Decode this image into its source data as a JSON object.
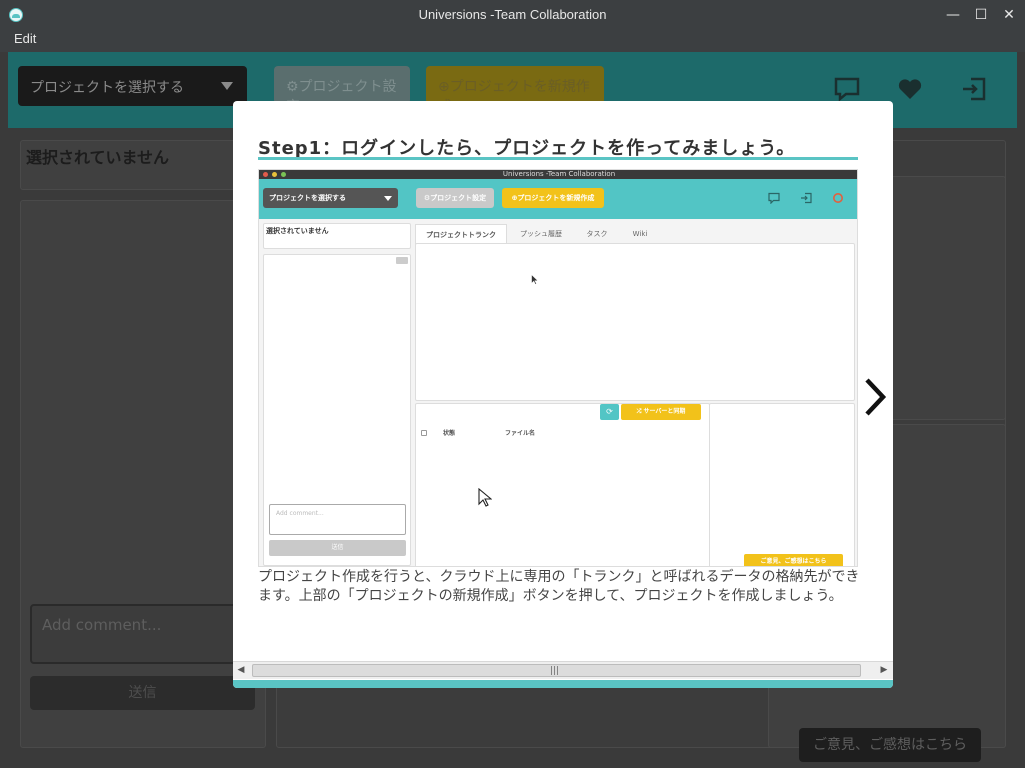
{
  "window": {
    "title": "Universions -Team Collaboration",
    "minimize": "—",
    "maximize": "☐",
    "close": "✕"
  },
  "menu": {
    "edit": "Edit"
  },
  "app": {
    "project_select_placeholder": "プロジェクトを選択する",
    "settings_button": "⚙プロジェクト設定",
    "new_project_button": "⊕プロジェクトを新規作成",
    "no_selection": "選択されていません",
    "comment_placeholder": "Add comment...",
    "send_button": "送信",
    "feedback_button": "ご意見、ご感想はこちら"
  },
  "modal": {
    "step_title": "Step1：ログインしたら、プロジェクトを作ってみましょう。",
    "description": "プロジェクト作成を行うと、クラウド上に専用の「トランク」と呼ばれるデータの格納先ができます。上部の「プロジェクトの新規作成」ボタンを押して、プロジェクトを作成しましょう。",
    "scroll_grip": "|||"
  },
  "screenshot": {
    "window_title": "Universions -Team Collaboration",
    "project_select": "プロジェクトを選択する",
    "settings_button": "⚙プロジェクト設定",
    "new_project_button": "⊕プロジェクトを新規作成",
    "no_selection": "選択されていません",
    "tabs": [
      "プロジェクトトランク",
      "プッシュ履歴",
      "タスク",
      "Wiki"
    ],
    "sync_button": "⤮ サーバーと同期",
    "col_status": "状態",
    "col_filename": "ファイル名",
    "comment_placeholder": "Add comment...",
    "send_button": "送信",
    "feedback_button": "ご意見、ご感想はこちら"
  },
  "colors": {
    "accent": "#5ac4c4",
    "yellow": "#f2c21a"
  }
}
